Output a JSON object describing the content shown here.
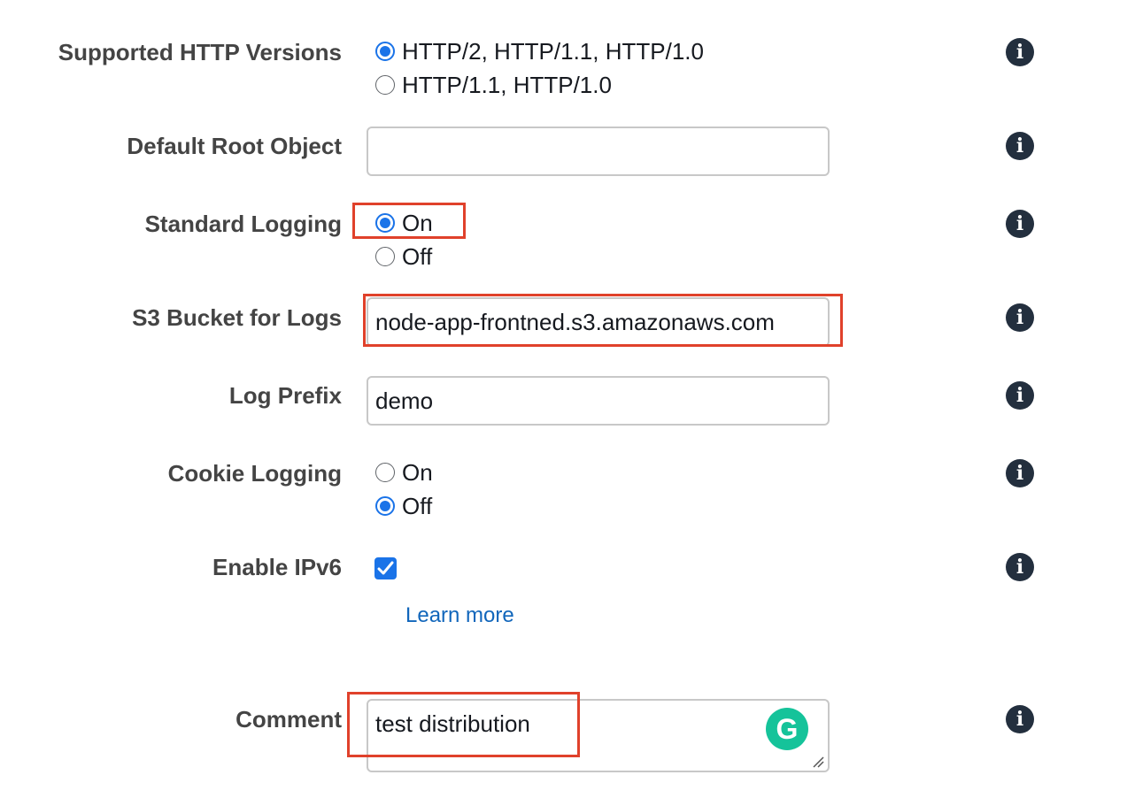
{
  "http_versions": {
    "label": "Supported HTTP Versions",
    "options": [
      "HTTP/2, HTTP/1.1, HTTP/1.0",
      "HTTP/1.1, HTTP/1.0"
    ],
    "selected": "HTTP/2, HTTP/1.1, HTTP/1.0"
  },
  "default_root_object": {
    "label": "Default Root Object",
    "value": ""
  },
  "standard_logging": {
    "label": "Standard Logging",
    "options": [
      "On",
      "Off"
    ],
    "selected": "On"
  },
  "s3_bucket": {
    "label": "S3 Bucket for Logs",
    "value": "node-app-frontned.s3.amazonaws.com"
  },
  "log_prefix": {
    "label": "Log Prefix",
    "value": "demo"
  },
  "cookie_logging": {
    "label": "Cookie Logging",
    "options": [
      "On",
      "Off"
    ],
    "selected": "Off"
  },
  "ipv6": {
    "label": "Enable IPv6",
    "checked": true,
    "learn_more": "Learn more"
  },
  "comment": {
    "label": "Comment",
    "value": "test distribution"
  },
  "icons": {
    "info": "info-icon",
    "info_glyph": "i",
    "grammarly": "grammarly-icon",
    "grammarly_glyph": "G"
  },
  "colors": {
    "accent": "#1a73e8",
    "highlight": "#e0412b",
    "label": "#444444",
    "link": "#1166bb",
    "info_icon": "#232f3e",
    "grammarly": "#15c39a"
  }
}
